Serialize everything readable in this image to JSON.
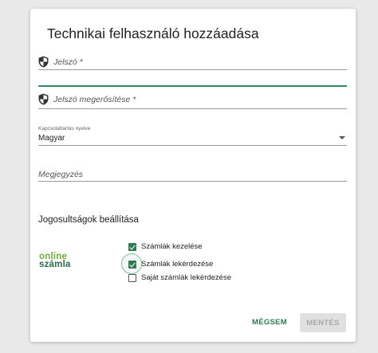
{
  "dialog": {
    "title": "Technikai felhasználó hozzáadása"
  },
  "form": {
    "password": {
      "placeholder": "Jelszó *",
      "icon": "shield-icon"
    },
    "password_confirm": {
      "placeholder": "Jelszó megerősítése *",
      "icon": "shield-icon"
    },
    "language": {
      "label": "Kapcsolattartás nyelve",
      "value": "Magyar"
    },
    "note": {
      "placeholder": "Megjegyzés"
    }
  },
  "permissions": {
    "title": "Jogosultságok beállítása",
    "logo_line1": "online",
    "logo_line2": "számla",
    "items": [
      {
        "label": "Számlák kezelése",
        "checked": true
      },
      {
        "label": "Számlák lekérdezése",
        "checked": true
      },
      {
        "label": "Saját számlák lekérdezése",
        "checked": false
      }
    ]
  },
  "actions": {
    "cancel": "MÉGSEM",
    "save": "MENTÉS"
  },
  "colors": {
    "accent": "#2e7d52",
    "focus_line": "#2e8b5e",
    "logo_light": "#6cab3a",
    "logo_dark": "#2d6b45"
  }
}
